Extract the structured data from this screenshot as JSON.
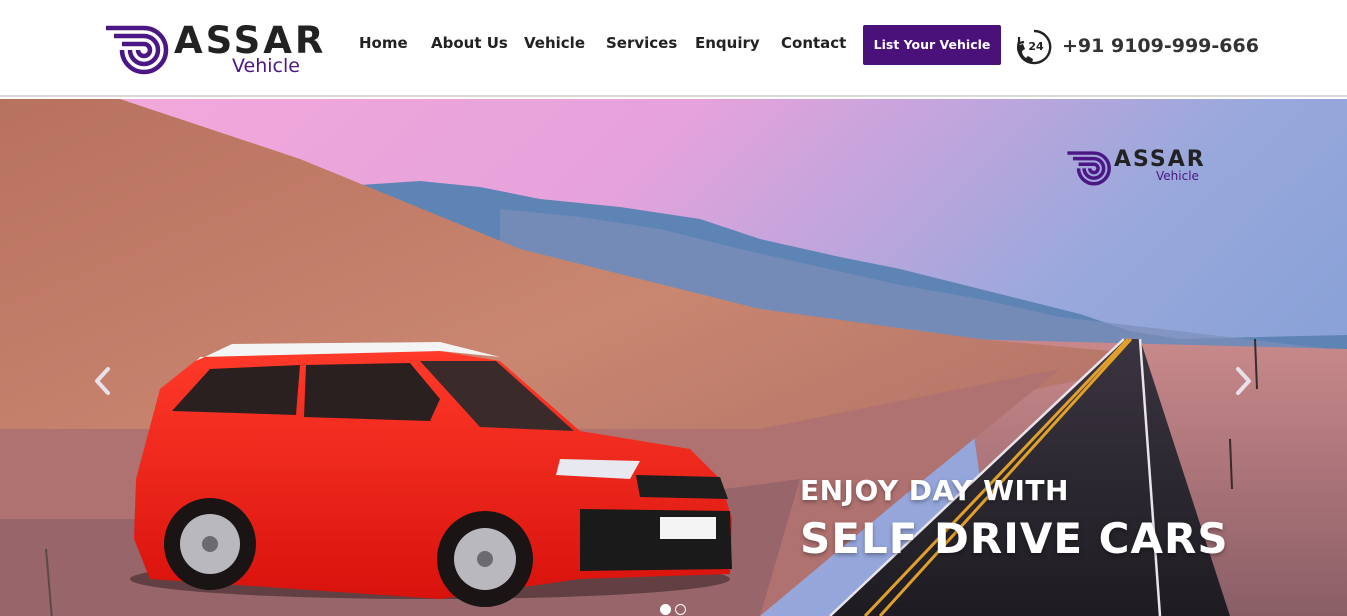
{
  "brand": {
    "logo_word": "ASSAR",
    "logo_sub": "Vehicle",
    "accent": "#4a117a",
    "icon": "logo-swirl-icon"
  },
  "nav": {
    "items": [
      {
        "label": "Home"
      },
      {
        "label": "About Us"
      },
      {
        "label": "Vehicle"
      },
      {
        "label": "Services"
      },
      {
        "label": "Enquiry"
      },
      {
        "label": "Contact"
      }
    ]
  },
  "cta": {
    "label": "List Your Vehicle",
    "color": "#4a117a"
  },
  "phone": {
    "icon": "24-hour-phone-icon",
    "icon_text": "24",
    "number": "+91 9109-999-666"
  },
  "hero": {
    "watermark_word": "ASSAR",
    "watermark_sub": "Vehicle",
    "caption_line1": "ENJOY DAY WITH",
    "caption_line2": "SELF DRIVE CARS",
    "prev_icon": "chevron-left-icon",
    "next_icon": "chevron-right-icon",
    "slides_total": 2,
    "active_slide": 1
  }
}
